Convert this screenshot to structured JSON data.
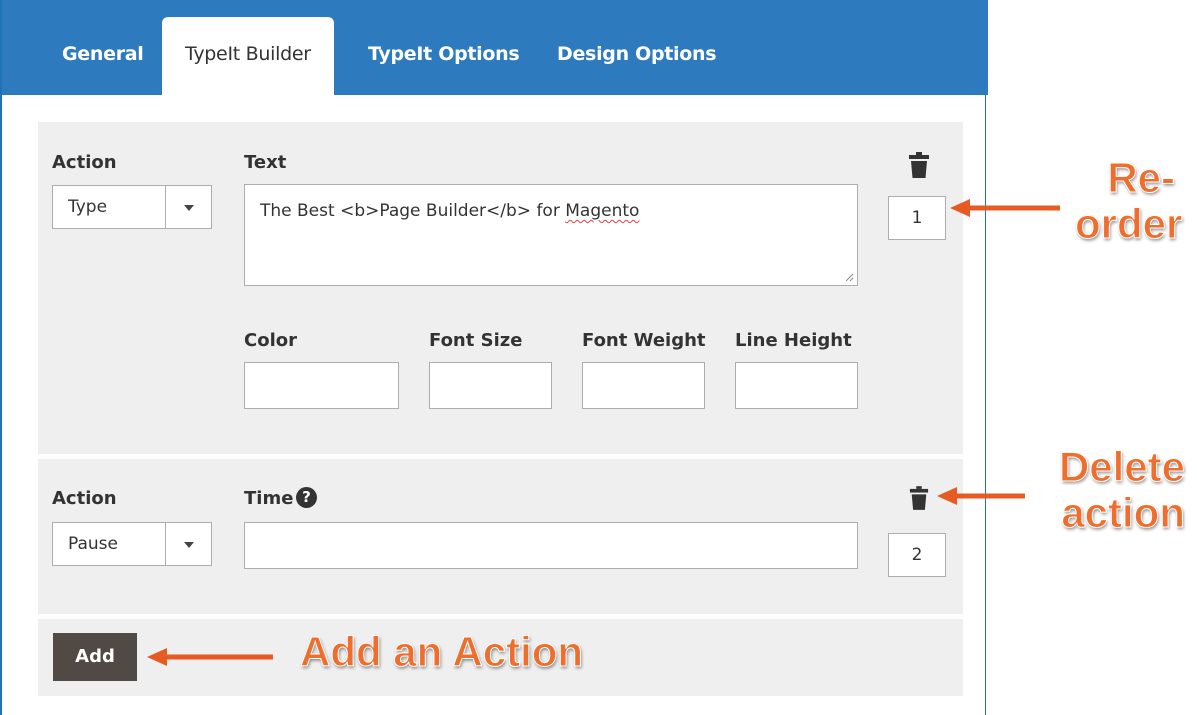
{
  "tabs": [
    {
      "label": "General",
      "active": false
    },
    {
      "label": "TypeIt Builder",
      "active": true
    },
    {
      "label": "TypeIt Options",
      "active": false
    },
    {
      "label": "Design Options",
      "active": false
    }
  ],
  "actions": [
    {
      "action_label": "Action",
      "action_value": "Type",
      "text_label": "Text",
      "text_value_before": "The Best <b>Page Builder</b> for ",
      "text_value_misspelled": "Magento",
      "color_label": "Color",
      "font_size_label": "Font Size",
      "font_weight_label": "Font Weight",
      "line_height_label": "Line Height",
      "order": "1"
    },
    {
      "action_label": "Action",
      "action_value": "Pause",
      "time_label": "Time",
      "time_help": "?",
      "order": "2"
    }
  ],
  "add_label": "Add",
  "annotations": {
    "reorder_line1": "Re-",
    "reorder_line2": "order",
    "delete_line1": "Delete",
    "delete_line2": "action",
    "add_action": "Add an Action"
  },
  "colors": {
    "tab_bar": "#2d7abf",
    "panel": "#efefef",
    "add_button": "#514943",
    "annotation": "#ee6f2d"
  }
}
